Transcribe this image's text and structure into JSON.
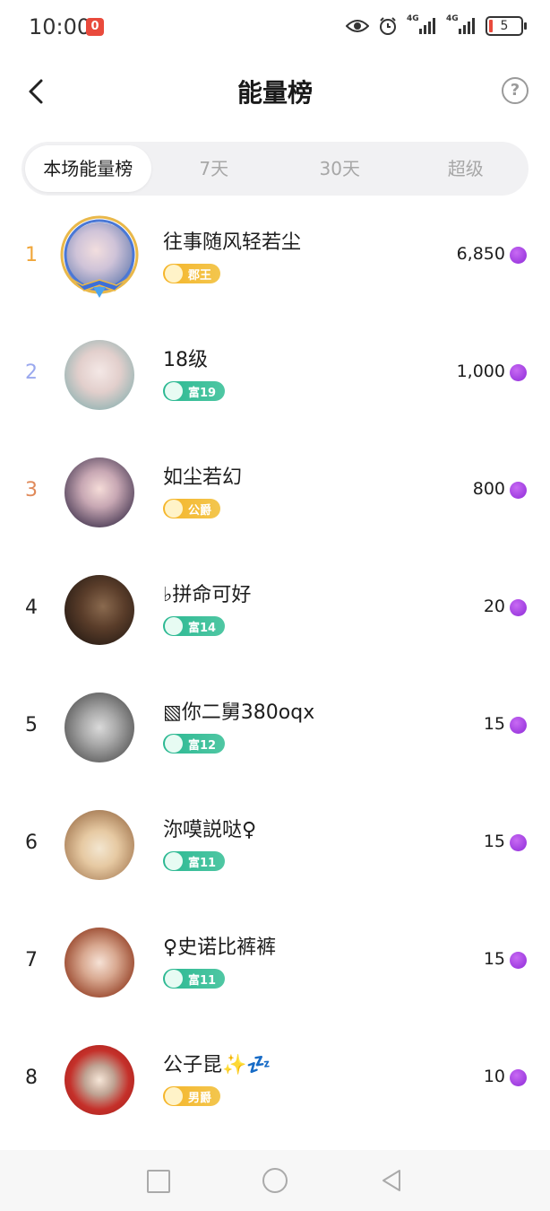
{
  "status_bar": {
    "time": "10:00",
    "notification_badge": "0",
    "battery": "5"
  },
  "header": {
    "title": "能量榜",
    "back_icon": "chevron-left-icon",
    "help_icon": "question-circle-icon",
    "help_glyph": "?"
  },
  "tabs": [
    {
      "label": "本场能量榜",
      "active": true
    },
    {
      "label": "7天",
      "active": false
    },
    {
      "label": "30天",
      "active": false
    },
    {
      "label": "超级",
      "active": false
    }
  ],
  "ranking": [
    {
      "rank": "1",
      "name": "往事随风轻若尘",
      "badge": "郡王",
      "badge_style": "gold",
      "value": "6,850"
    },
    {
      "rank": "2",
      "name": "18级",
      "badge": "富19",
      "badge_style": "green",
      "value": "1,000"
    },
    {
      "rank": "3",
      "name": "如尘若幻",
      "badge": "公爵",
      "badge_style": "gold",
      "value": "800"
    },
    {
      "rank": "4",
      "name": "♭拼命可好",
      "badge": "富14",
      "badge_style": "green",
      "value": "20"
    },
    {
      "rank": "5",
      "name": "▧你二舅380oqx",
      "badge": "富12",
      "badge_style": "green",
      "value": "15"
    },
    {
      "rank": "6",
      "name": "沵嗼説哒♀",
      "badge": "富11",
      "badge_style": "green",
      "value": "15"
    },
    {
      "rank": "7",
      "name": "♀史诺比裤裤",
      "badge": "富11",
      "badge_style": "green",
      "value": "15"
    },
    {
      "rank": "8",
      "name": "公子昆✨💤",
      "badge": "男爵",
      "badge_style": "gold",
      "value": "10"
    }
  ],
  "colors": {
    "rank1": "#f0a63a",
    "rank2": "#9aa8ee",
    "rank3": "#e08a5a",
    "gold_badge": "#f5b52a",
    "green_badge": "#2bb892",
    "energy": "#8e2bd8"
  },
  "energy_icon": "lightning-bolt-icon",
  "nav_bar": {
    "recents": "square-icon",
    "home": "circle-icon",
    "back": "triangle-back-icon"
  }
}
